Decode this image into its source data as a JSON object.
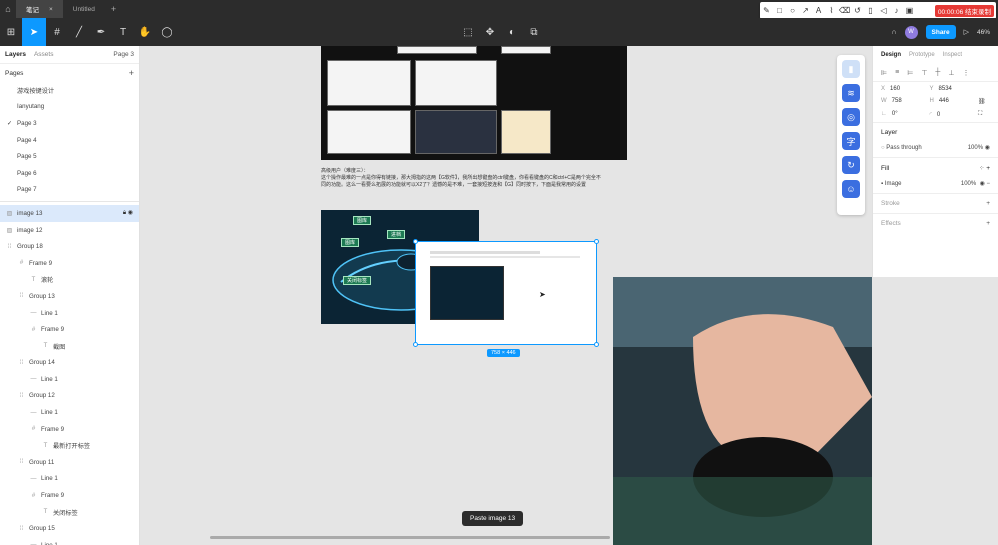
{
  "titlebar": {
    "tabs": [
      {
        "label": "笔记",
        "active": true
      },
      {
        "label": "Untitled",
        "active": false
      }
    ]
  },
  "recorder": {
    "timer": "00:00:06 结束录制"
  },
  "toolbar": {
    "share_label": "Share",
    "avatar_letter": "W",
    "zoom": "46%"
  },
  "left_panel": {
    "tabs": [
      "Layers",
      "Assets"
    ],
    "page_selector": "Page 3",
    "pages_header": "Pages",
    "pages": [
      {
        "label": "游戏按键设计",
        "current": false
      },
      {
        "label": "Ianyutang",
        "current": false
      },
      {
        "label": "Page 3",
        "current": true
      },
      {
        "label": "Page 4",
        "current": false
      },
      {
        "label": "Page 5",
        "current": false
      },
      {
        "label": "Page 6",
        "current": false
      },
      {
        "label": "Page 7",
        "current": false
      }
    ],
    "layers": [
      {
        "label": "image 13",
        "depth": 0,
        "icon": "image",
        "selected": true
      },
      {
        "label": "image 12",
        "depth": 0,
        "icon": "image"
      },
      {
        "label": "Group 18",
        "depth": 0,
        "icon": "group"
      },
      {
        "label": "Frame 9",
        "depth": 1,
        "icon": "frame"
      },
      {
        "label": "滚轮",
        "depth": 2,
        "icon": "text"
      },
      {
        "label": "Group 13",
        "depth": 1,
        "icon": "group"
      },
      {
        "label": "Line 1",
        "depth": 2,
        "icon": "line"
      },
      {
        "label": "Frame 9",
        "depth": 2,
        "icon": "frame"
      },
      {
        "label": "截图",
        "depth": 3,
        "icon": "text"
      },
      {
        "label": "Group 14",
        "depth": 1,
        "icon": "group"
      },
      {
        "label": "Line 1",
        "depth": 2,
        "icon": "line"
      },
      {
        "label": "Group 12",
        "depth": 1,
        "icon": "group"
      },
      {
        "label": "Line 1",
        "depth": 2,
        "icon": "line"
      },
      {
        "label": "Frame 9",
        "depth": 2,
        "icon": "frame"
      },
      {
        "label": "最新打开标签",
        "depth": 3,
        "icon": "text"
      },
      {
        "label": "Group 11",
        "depth": 1,
        "icon": "group"
      },
      {
        "label": "Line 1",
        "depth": 2,
        "icon": "line"
      },
      {
        "label": "Frame 9",
        "depth": 2,
        "icon": "frame"
      },
      {
        "label": "关闭标签",
        "depth": 3,
        "icon": "text"
      },
      {
        "label": "Group 15",
        "depth": 1,
        "icon": "group"
      },
      {
        "label": "Line 1",
        "depth": 2,
        "icon": "line"
      }
    ]
  },
  "canvas": {
    "caption_line1": "高级用户（难度三）：",
    "caption_line2": "这个操作最难的一点是你得有链接，那大拇指的这两【G软件】，我所出想键盘的ctrl键盘，你看看键盘的C和ctrl+C是两个完全不",
    "caption_line3": "同的功能。这么一看要么拓展的功能就可以X2了？遗憾的是不难，一套接短按连和【G】同时按下，下面是我常用的设置",
    "mouse_labels": [
      "图库",
      "进档",
      "图库",
      "关闭标签"
    ],
    "selection_size": "758 × 446",
    "toast": "Paste image 13"
  },
  "right_panel": {
    "tabs": [
      "Design",
      "Prototype",
      "Inspect"
    ],
    "x": "160",
    "y": "8534",
    "w": "758",
    "h": "446",
    "rotation": "0°",
    "radius": "0",
    "layer_header": "Layer",
    "blend": "Pass through",
    "opacity": "100%",
    "fill_header": "Fill",
    "fill_type": "Image",
    "fill_opacity": "100%",
    "stroke_header": "Stroke",
    "effects_header": "Effects"
  }
}
